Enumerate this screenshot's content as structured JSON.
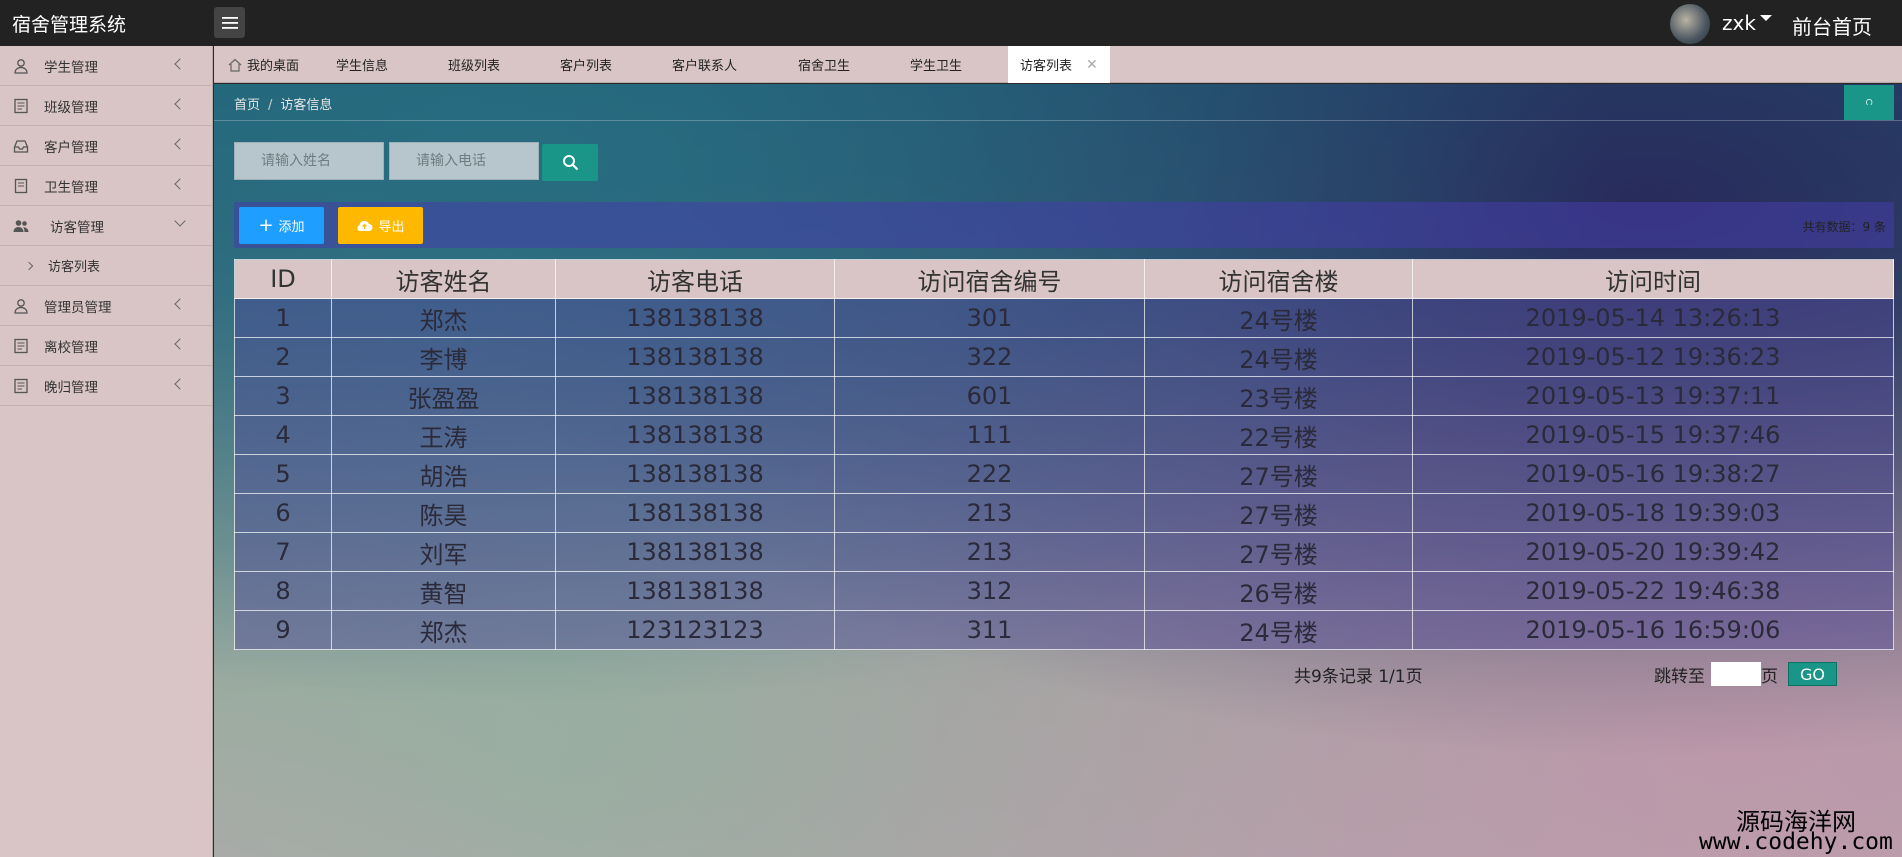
{
  "app": {
    "title": "宿舍管理系统"
  },
  "header": {
    "username": "zxk",
    "frontpage_link": "前台首页"
  },
  "sidebar": {
    "items": [
      {
        "label": "学生管理",
        "icon": "user-icon"
      },
      {
        "label": "班级管理",
        "icon": "document-icon"
      },
      {
        "label": "客户管理",
        "icon": "inbox-icon"
      },
      {
        "label": "卫生管理",
        "icon": "notepad-icon"
      },
      {
        "label": "访客管理",
        "icon": "users-icon",
        "expanded": true
      },
      {
        "label": "管理员管理",
        "icon": "user-icon"
      },
      {
        "label": "离校管理",
        "icon": "document-icon"
      },
      {
        "label": "晚归管理",
        "icon": "document-icon"
      }
    ],
    "sub_items": [
      {
        "label": "访客列表"
      }
    ]
  },
  "tabs": [
    {
      "label": "我的桌面"
    },
    {
      "label": "学生信息"
    },
    {
      "label": "班级列表"
    },
    {
      "label": "客户列表"
    },
    {
      "label": "客户联系人"
    },
    {
      "label": "宿舍卫生"
    },
    {
      "label": "学生卫生"
    },
    {
      "label": "访客列表",
      "active": true
    }
  ],
  "breadcrumb": {
    "home": "首页",
    "current": "访客信息"
  },
  "refresh_label": "ဂ",
  "search": {
    "name_placeholder": "请输入姓名",
    "phone_placeholder": "请输入电话"
  },
  "toolbar": {
    "add_label": "添加",
    "export_label": "导出",
    "total_text": "共有数据：9 条"
  },
  "table": {
    "headers": [
      "ID",
      "访客姓名",
      "访客电话",
      "访问宿舍编号",
      "访问宿舍楼",
      "访问时间"
    ],
    "rows": [
      [
        "1",
        "郑杰",
        "138138138",
        "301",
        "24号楼",
        "2019-05-14 13:26:13"
      ],
      [
        "2",
        "李博",
        "138138138",
        "322",
        "24号楼",
        "2019-05-12 19:36:23"
      ],
      [
        "3",
        "张盈盈",
        "138138138",
        "601",
        "23号楼",
        "2019-05-13 19:37:11"
      ],
      [
        "4",
        "王涛",
        "138138138",
        "111",
        "22号楼",
        "2019-05-15 19:37:46"
      ],
      [
        "5",
        "胡浩",
        "138138138",
        "222",
        "27号楼",
        "2019-05-16 19:38:27"
      ],
      [
        "6",
        "陈昊",
        "138138138",
        "213",
        "27号楼",
        "2019-05-18 19:39:03"
      ],
      [
        "7",
        "刘军",
        "138138138",
        "213",
        "27号楼",
        "2019-05-20 19:39:42"
      ],
      [
        "8",
        "黄智",
        "138138138",
        "312",
        "26号楼",
        "2019-05-22 19:46:38"
      ],
      [
        "9",
        "郑杰",
        "123123123",
        "311",
        "24号楼",
        "2019-05-16 16:59:06"
      ]
    ]
  },
  "pager": {
    "info": "共9条记录  1/1页",
    "jump_label": "跳转至",
    "page_unit": "页",
    "go_label": "GO"
  },
  "watermark": {
    "line1": "源码海洋网",
    "line2": "www.codehy.com"
  },
  "colors": {
    "accent": "#1a9688",
    "add": "#1e9fff",
    "export": "#ffb800",
    "sidebar_bg": "#d9c5c5"
  }
}
